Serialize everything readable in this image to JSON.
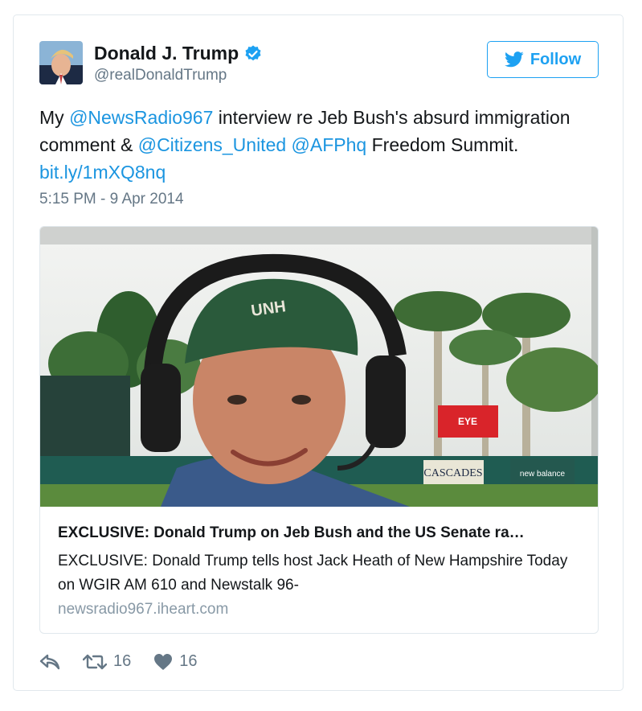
{
  "author": {
    "display_name": "Donald J. Trump",
    "handle": "@realDonaldTrump",
    "verified_icon": "verified-badge-icon",
    "avatar": "avatar"
  },
  "follow_button": {
    "label": "Follow",
    "icon": "twitter-bird-icon"
  },
  "tweet": {
    "parts": {
      "p1": "My ",
      "m1": "@NewsRadio967",
      "p2": " interview re Jeb Bush's absurd immigration comment & ",
      "m2": "@Citizens_United",
      "p3": " ",
      "m3": "@AFPhq",
      "p4": " Freedom Summit. ",
      "link": "bit.ly/1mXQ8nq"
    },
    "timestamp": "5:15 PM - 9 Apr 2014"
  },
  "link_card": {
    "title": "EXCLUSIVE: Donald Trump on Jeb Bush and the US Senate ra…",
    "description": "EXCLUSIVE: Donald Trump tells host Jack Heath of New Hampshire Today on WGIR AM 610 and Newstalk 96-",
    "domain": "newsradio967.iheart.com",
    "image_texts": {
      "cap_text": "UNH",
      "sign_cascades": "CASCADES",
      "sign_nb": "new balance",
      "sign_red": "EYE"
    }
  },
  "actions": {
    "reply_icon": "reply-icon",
    "retweet_icon": "retweet-icon",
    "retweet_count": "16",
    "like_icon": "heart-icon",
    "like_count": "16"
  },
  "colors": {
    "accent": "#1da1f2",
    "link": "#1b95e0",
    "secondary_text": "#657786",
    "border": "#e1e8ed"
  }
}
